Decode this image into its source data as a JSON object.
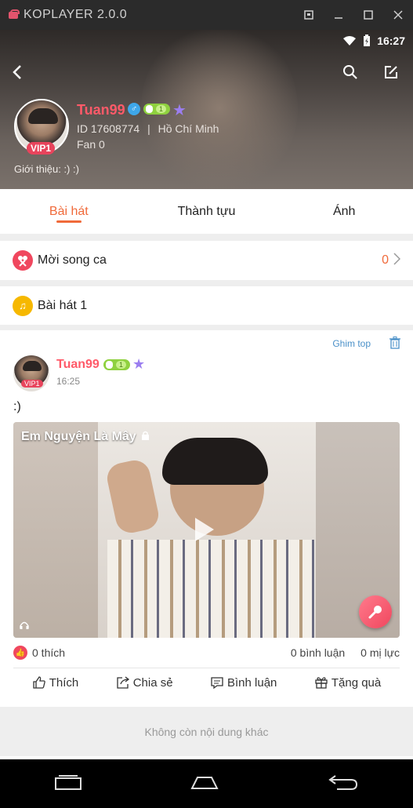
{
  "window": {
    "title": "KOPLAYER 2.0.0"
  },
  "status": {
    "time": "16:27"
  },
  "profile": {
    "name": "Tuan99",
    "vip": "VIP1",
    "level": "1",
    "id_text": "ID 17608774",
    "separator": "|",
    "location": "Hồ Chí Minh",
    "fans": "Fan 0",
    "intro": "Giới thiệu: :) :)"
  },
  "tabs": [
    {
      "label": "Bài hát"
    },
    {
      "label": "Thành tựu"
    },
    {
      "label": "Ánh"
    }
  ],
  "duet": {
    "label": "Mời song ca",
    "count": "0"
  },
  "songs": {
    "label": "Bài hát 1"
  },
  "post": {
    "pin_label": "Ghim top",
    "author": "Tuan99",
    "vip": "VIP1",
    "level": "1",
    "time": "16:25",
    "content": ":)",
    "song_title": "Em Nguyện Là Mây",
    "likes": "0 thích",
    "comments": "0 bình luận",
    "gifts_count": "0 mị lực",
    "actions": {
      "like": "Thích",
      "share": "Chia sẻ",
      "comment": "Bình luận",
      "gift": "Tặng quà"
    }
  },
  "footer": {
    "text": "Không còn nội dung khác"
  },
  "colors": {
    "accent": "#f06a3a",
    "name": "#ff5a69",
    "vip": "#e8445c",
    "link": "#4a90c8"
  }
}
